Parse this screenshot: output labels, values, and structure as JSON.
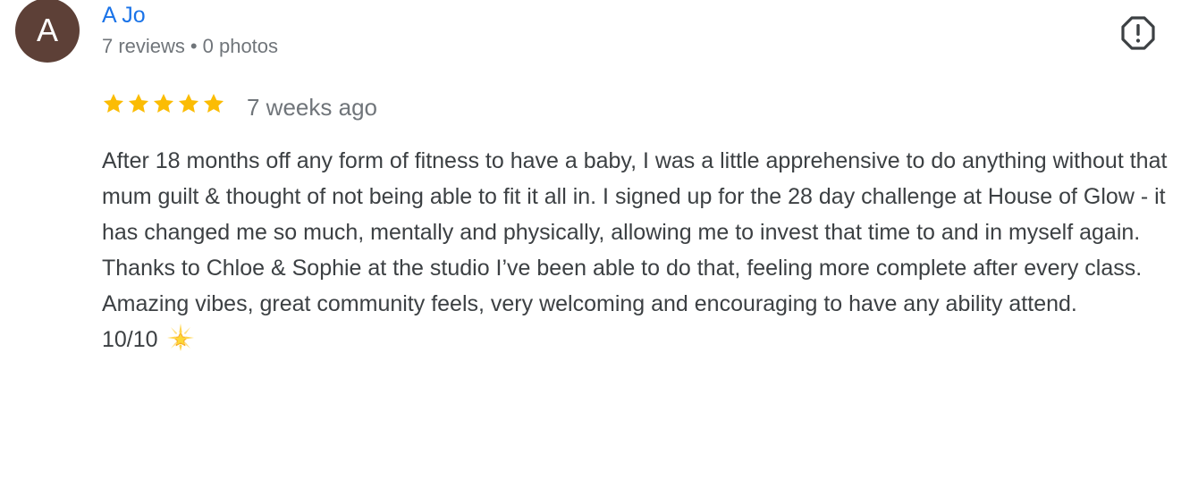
{
  "review": {
    "avatar_letter": "A",
    "author": "A Jo",
    "reviews_count": "7 reviews",
    "photos_count": "0 photos",
    "separator": "•",
    "rating": 5,
    "rating_max": 5,
    "date": "7 weeks ago",
    "paragraphs": [
      "After 18 months off any form of fitness to have a baby, I was a little apprehensive to do anything without that mum guilt & thought of not being able to fit it all in. I signed up for the 28 day challenge at House of Glow - it has changed me so much, mentally and physically, allowing me to invest that time to and in myself again.",
      "Thanks to Chloe & Sophie at the studio I’ve been able to do that, feeling more complete after every class.",
      "Amazing vibes, great community feels, very welcoming and encouraging to have any ability attend."
    ],
    "score_text": "10/10",
    "score_emoji": "glowing-star-emoji"
  },
  "colors": {
    "avatar_bg": "#5d4037",
    "author": "#1a73e8",
    "star": "#fbbc04",
    "muted": "#70757a",
    "text": "#3c4043"
  },
  "icons": {
    "report": "report-octagon-icon",
    "star": "star-icon"
  }
}
